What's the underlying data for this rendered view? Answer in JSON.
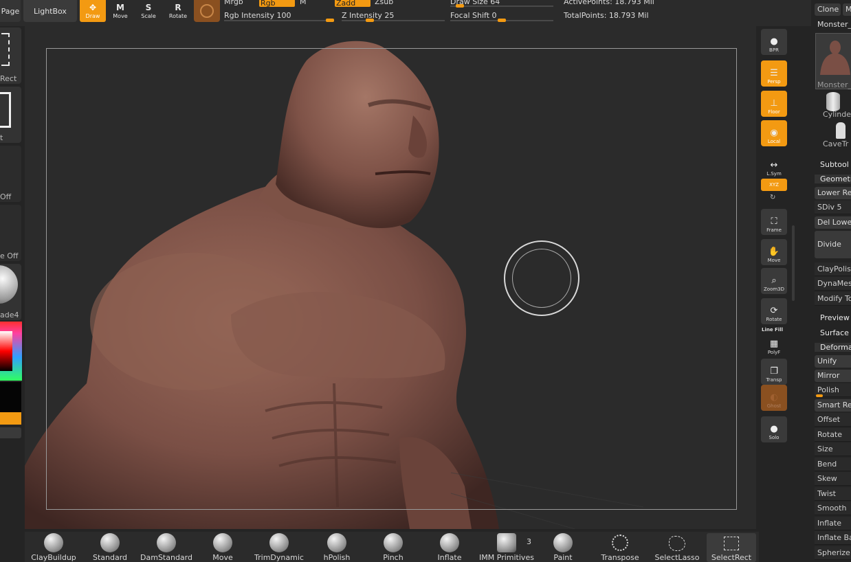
{
  "topbar": {
    "page_label": "Page",
    "lightbox_label": "LightBox",
    "tools": [
      {
        "label": "Draw",
        "icon": "draw-icon"
      },
      {
        "label": "Move",
        "icon": "move-icon"
      },
      {
        "label": "Scale",
        "icon": "scale-icon"
      },
      {
        "label": "Rotate",
        "icon": "rotate-icon"
      }
    ],
    "mrgb": "Mrgb",
    "rgb": "Rgb",
    "m": "M",
    "zadd": "Zadd",
    "zsub": "Zsub",
    "rgb_intensity": "Rgb Intensity 100",
    "z_intensity": "Z Intensity 25",
    "draw_size": "Draw Size 64",
    "focal_shift": "Focal Shift 0",
    "active_points": "ActivePoints: 18.793 Mil",
    "total_points": "TotalPoints: 18.793 Mil",
    "rgb_intensity_level": 1.0,
    "z_intensity_level": 0.25,
    "draw_size_level": 0.06,
    "focal_shift_level": 0.5
  },
  "leftstrip": {
    "rect_label": "Rect",
    "t_label": "t",
    "off1": "Off",
    "off2": "e Off",
    "shade": "ade4"
  },
  "shelf": {
    "bpr": "BPR",
    "persp": "Persp",
    "floor": "Floor",
    "local": "Local",
    "lsym": "L.Sym",
    "xyz": "XYZ",
    "frame": "Frame",
    "move": "Move",
    "zoom3d": "Zoom3D",
    "rotate": "Rotate",
    "linefill": "Line Fill",
    "polyf": "PolyF",
    "transp": "Transp",
    "ghost": "Ghost",
    "solo": "Solo"
  },
  "rpanel": {
    "clone": "Clone",
    "m": "M",
    "tool_name": "Monster_s",
    "thumb_label": "Monster_",
    "cylinder": "Cylinde",
    "cavetr": "CaveTr",
    "subtool": "Subtool",
    "geometry": "Geometr",
    "lower_res": "Lower Res",
    "sdiv": "SDiv 5",
    "del_lower": "Del Lower",
    "divide": "Divide",
    "claypolish": "ClayPolish",
    "dynamesh": "DynaMesh",
    "modify": "Modify To",
    "preview": "Preview",
    "surface": "Surface",
    "deformation": "Deformat",
    "deform_items": [
      "Unify",
      "Mirror",
      "Polish",
      "Smart ReS",
      "Offset",
      "Rotate",
      "Size",
      "Bend",
      "Skew",
      "Twist",
      "Smooth",
      "Inflate",
      "Inflate Bal",
      "Spherize"
    ]
  },
  "bottombar": {
    "brushes": [
      "ClayBuildup",
      "Standard",
      "DamStandard",
      "Move",
      "TrimDynamic",
      "hPolish",
      "Pinch",
      "Inflate",
      "IMM Primitives",
      "Paint",
      "Transpose",
      "SelectLasso",
      "SelectRect"
    ],
    "imm_count": "3"
  },
  "colors": {
    "accent": "#f39a12",
    "material": "#8a5020",
    "skin": "#7a4f45"
  }
}
